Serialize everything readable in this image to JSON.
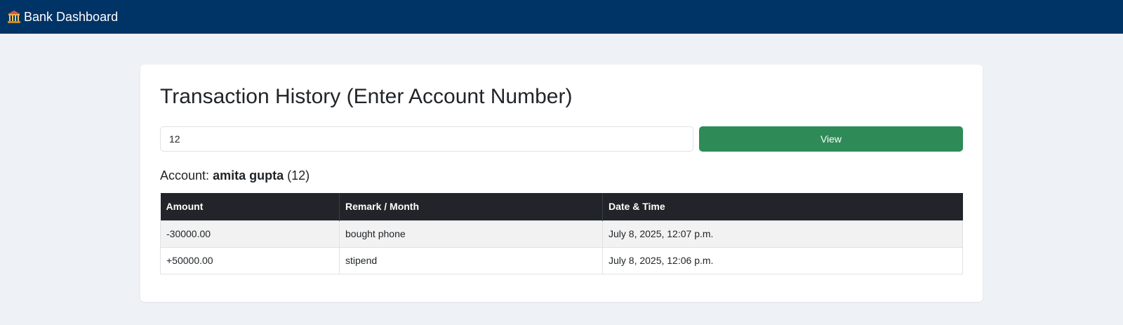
{
  "navbar": {
    "brand_label": "Bank Dashboard",
    "brand_icon": "bank-icon"
  },
  "card": {
    "title": "Transaction History (Enter Account Number)",
    "input_value": "12",
    "view_label": "View",
    "account_prefix": "Account:",
    "account_name": "amita gupta",
    "account_number_display": "(12)"
  },
  "table": {
    "headers": [
      "Amount",
      "Remark / Month",
      "Date & Time"
    ],
    "rows": [
      {
        "amount": "-30000.00",
        "remark": "bought phone",
        "datetime": "July 8, 2025, 12:07 p.m."
      },
      {
        "amount": "+50000.00",
        "remark": "stipend",
        "datetime": "July 8, 2025, 12:06 p.m."
      }
    ]
  },
  "colors": {
    "navbar_bg": "#003366",
    "button_bg": "#2e8b57",
    "table_header_bg": "#212529",
    "page_bg": "#eef2f7"
  }
}
